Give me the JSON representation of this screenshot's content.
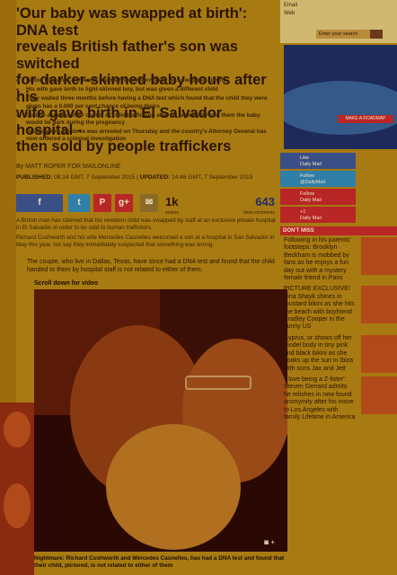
{
  "headline": {
    "lines": [
      "'Our baby was swapped at birth': DNA test",
      "reveals British father's son was switched",
      "for darker-skinned baby hours after his",
      "wife gave birth in El Salvador hospital -",
      "then sold by people traffickers"
    ]
  },
  "bullets": [
    "Briton Richard Cushworth claims his newborn baby was swapped at birth",
    "His wife gave birth to light-skinned boy, but was given a different child",
    "They waited three months before having a DNA test which found that the child they were given has a 0.000 per cent chance of being theirs",
    "Couple accused their doctor of child trafficking after he repeatedly told them the baby would be dark during the pregnancy",
    "Dr Alejandro Cordova was arrested on Thursday and the country's Attorney General has now ordered a criminal investigation"
  ],
  "byline": "By MATT ROPER FOR MAILONLINE",
  "published": {
    "published_label": "PUBLISHED:",
    "published_value": "08:14 GMT, 7 September 2015",
    "updated_label": "UPDATED:",
    "updated_value": "14:46 GMT, 7 September 2015"
  },
  "share": {
    "share_count": "1k",
    "share_label": "shares",
    "view_count": "643",
    "view_label": "View comments"
  },
  "body": [
    "A British man has claimed that his newborn child was swapped by staff at an exclusive private hospital in El Salvador in order to be sold to human traffickers.",
    "Richard Cushworth and his wife Mercedes Casnelles welcomed a son at a hospital in San Salvador in May this year, but say they immediately suspected that something was wrong."
  ],
  "video": {
    "caption": "The couple, who live in Dallas, Texas, have since had a DNA test and found that the child handed to them by hospital staff is not related to either of them.",
    "scroll_label": "Scroll down for video",
    "photo_caption": "Nightmare: Richard Cushworth and Mercedes Casnelles, has had a DNA test and found that their child, pictured, is not related to either of them"
  },
  "right_column": {
    "newsletter_row1": "Email",
    "newsletter_row2": "Web",
    "subscribe_placeholder": "Enter your search",
    "ad_button": "MAKE A ROADMAP",
    "social": [
      {
        "label": "Like",
        "sub": "Daily Mail",
        "icon": "facebook-icon"
      },
      {
        "label": "Follow",
        "sub": "@DailyMail",
        "icon": "twitter-icon"
      },
      {
        "label": "Follow",
        "sub": "Daily Mail",
        "icon": "pinterest-icon"
      },
      {
        "label": "+1",
        "sub": "Daily Mail",
        "icon": "google-plus-icon"
      }
    ],
    "dont_miss": "DON'T MISS",
    "stories": [
      {
        "title": "Following in his parents' footsteps: Brooklyn Beckham is mobbed by fans as he enjoys a fun day out with a mystery female friend in Paris",
        "highlight": "Following in his parents' footsteps"
      },
      {
        "title": "PICTURE EXCLUSIVE! Irina Shayk shines in mustard bikini as she hits the beach with boyfriend Bradley Cooper in the sunny US",
        "highlight": "PICTURE EXCLUSIVE!"
      },
      {
        "title": "Cyprus, or shows off her model body in tiny pink and black bikini as she soaks up the sun in Ibiza with sons Jax and Jett",
        "highlight": "Cyprus"
      },
      {
        "title": "'I love being a Z-lister': Steven Gerrard admits he relishes in new found anonymity after his move to Los Angeles with family Lifetime in America",
        "highlight": "'I love being a Z-lister'"
      }
    ]
  }
}
